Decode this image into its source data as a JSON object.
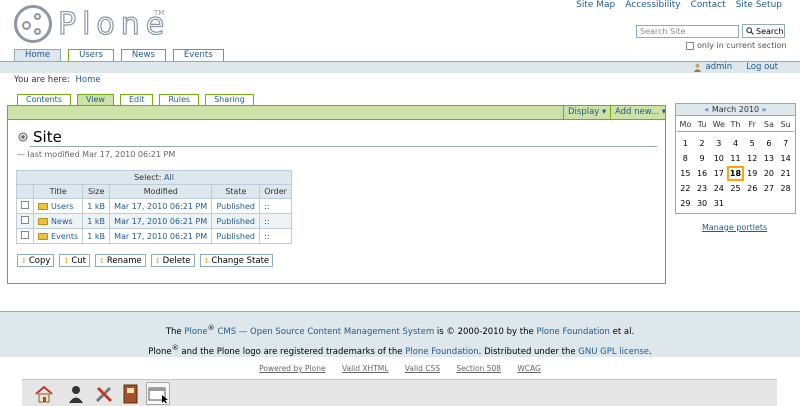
{
  "header": {
    "logo_text": "Plone",
    "logo_tm": "TM",
    "site_actions": [
      "Site Map",
      "Accessibility",
      "Contact",
      "Site Setup"
    ],
    "search": {
      "placeholder": "Search Site",
      "button_label": "Search",
      "only_in_section": "only in current section"
    }
  },
  "portal_tabs": [
    {
      "label": "Home",
      "active": true
    },
    {
      "label": "Users",
      "active": false
    },
    {
      "label": "News",
      "active": false
    },
    {
      "label": "Events",
      "active": false
    }
  ],
  "personal_bar": {
    "user": "admin",
    "logout": "Log out"
  },
  "breadcrumb": {
    "prefix": "You are here:",
    "items": [
      "Home"
    ]
  },
  "content_views": [
    {
      "label": "Contents",
      "active": false
    },
    {
      "label": "View",
      "active": true
    },
    {
      "label": "Edit",
      "active": false
    },
    {
      "label": "Rules",
      "active": false
    },
    {
      "label": "Sharing",
      "active": false
    }
  ],
  "content_actions": {
    "display": "Display ▾",
    "add_new": "Add new... ▾"
  },
  "page": {
    "title": "Site",
    "byline": "— last modified Mar 17, 2010 06:21 PM"
  },
  "folder_contents": {
    "select_label": "Select:",
    "select_all": "All",
    "columns": [
      "Title",
      "Size",
      "Modified",
      "State",
      "Order"
    ],
    "rows": [
      {
        "title": "Users",
        "size": "1 kB",
        "modified": "Mar 17, 2010 06:21 PM",
        "state": "Published",
        "order": "::"
      },
      {
        "title": "News",
        "size": "1 kB",
        "modified": "Mar 17, 2010 06:21 PM",
        "state": "Published",
        "order": "::"
      },
      {
        "title": "Events",
        "size": "1 kB",
        "modified": "Mar 17, 2010 06:21 PM",
        "state": "Published",
        "order": "::"
      }
    ],
    "buttons": [
      "Copy",
      "Cut",
      "Rename",
      "Delete",
      "Change State"
    ]
  },
  "calendar": {
    "prev": "«",
    "month": "March 2010",
    "next": "»",
    "weekdays": [
      "Mo",
      "Tu",
      "We",
      "Th",
      "Fr",
      "Sa",
      "Su"
    ],
    "weeks": [
      [
        "1",
        "2",
        "3",
        "4",
        "5",
        "6",
        "7"
      ],
      [
        "8",
        "9",
        "10",
        "11",
        "12",
        "13",
        "14"
      ],
      [
        "15",
        "16",
        "17",
        "18",
        "19",
        "20",
        "21"
      ],
      [
        "22",
        "23",
        "24",
        "25",
        "26",
        "27",
        "28"
      ],
      [
        "29",
        "30",
        "31",
        "",
        "",
        "",
        ""
      ]
    ],
    "today": "18",
    "manage_portlets": "Manage portlets"
  },
  "footer": {
    "line1_a": "The ",
    "line1_plone": "Plone",
    "line1_reg": "®",
    "line1_cms": " CMS — Open Source Content Management System",
    "line1_b": " is © 2000-2010 by the ",
    "line1_foundation": "Plone Foundation",
    "line1_c": " et al.",
    "line2_a": "Plone",
    "line2_reg": "®",
    "line2_b": " and the Plone logo are registered trademarks of the ",
    "line2_foundation": "Plone Foundation",
    "line2_c": ". Distributed under the ",
    "line2_license": "GNU GPL license",
    "line2_d": "."
  },
  "colophon": [
    "Powered by Plone",
    "Valid XHTML",
    "Valid CSS",
    "Section 508",
    "WCAG"
  ],
  "taskbar": {
    "icons": [
      "home-icon",
      "user-icon",
      "tools-icon",
      "address-book-icon",
      "window-icon"
    ],
    "active_index": 4
  }
}
